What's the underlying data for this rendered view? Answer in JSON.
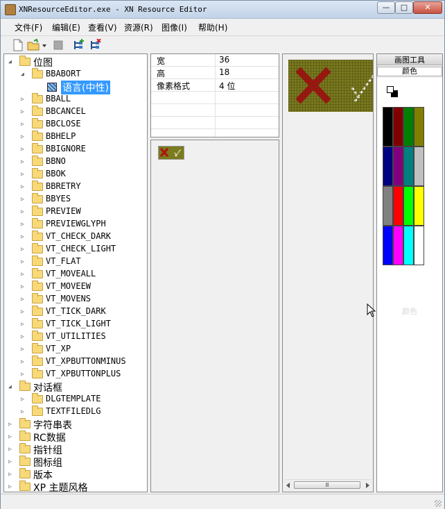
{
  "window": {
    "title": "XNResourceEditor.exe - XN Resource Editor"
  },
  "title_buttons": {
    "minimize": "—",
    "maximize": "□",
    "close": "✕"
  },
  "menu": [
    "文件(F)",
    "编辑(E)",
    "查看(V)",
    "资源(R)",
    "图像(I)",
    "帮助(H)"
  ],
  "tree": [
    {
      "label": "位图",
      "cn": true,
      "level": 0,
      "expanded": true
    },
    {
      "label": "BBABORT",
      "level": 1,
      "expanded": true
    },
    {
      "label": "语言(中性)",
      "cn": true,
      "level": 2,
      "selected": true
    },
    {
      "label": "BBALL",
      "level": 1
    },
    {
      "label": "BBCANCEL",
      "level": 1
    },
    {
      "label": "BBCLOSE",
      "level": 1
    },
    {
      "label": "BBHELP",
      "level": 1
    },
    {
      "label": "BBIGNORE",
      "level": 1
    },
    {
      "label": "BBNO",
      "level": 1
    },
    {
      "label": "BBOK",
      "level": 1
    },
    {
      "label": "BBRETRY",
      "level": 1
    },
    {
      "label": "BBYES",
      "level": 1
    },
    {
      "label": "PREVIEW",
      "level": 1
    },
    {
      "label": "PREVIEWGLYPH",
      "level": 1
    },
    {
      "label": "VT_CHECK_DARK",
      "level": 1
    },
    {
      "label": "VT_CHECK_LIGHT",
      "level": 1
    },
    {
      "label": "VT_FLAT",
      "level": 1
    },
    {
      "label": "VT_MOVEALL",
      "level": 1
    },
    {
      "label": "VT_MOVEEW",
      "level": 1
    },
    {
      "label": "VT_MOVENS",
      "level": 1
    },
    {
      "label": "VT_TICK_DARK",
      "level": 1
    },
    {
      "label": "VT_TICK_LIGHT",
      "level": 1
    },
    {
      "label": "VT_UTILITIES",
      "level": 1
    },
    {
      "label": "VT_XP",
      "level": 1
    },
    {
      "label": "VT_XPBUTTONMINUS",
      "level": 1
    },
    {
      "label": "VT_XPBUTTONPLUS",
      "level": 1
    },
    {
      "label": "对话框",
      "cn": true,
      "level": 0,
      "expanded": true
    },
    {
      "label": "DLGTEMPLATE",
      "level": 1
    },
    {
      "label": "TEXTFILEDLG",
      "level": 1
    },
    {
      "label": "字符串表",
      "cn": true,
      "level": 0
    },
    {
      "label": "RC数据",
      "cn": true,
      "level": 0
    },
    {
      "label": "指针组",
      "cn": true,
      "level": 0
    },
    {
      "label": "图标组",
      "cn": true,
      "level": 0
    },
    {
      "label": "版本",
      "cn": true,
      "level": 0
    },
    {
      "label": "XP 主题风格",
      "cn": true,
      "level": 0
    }
  ],
  "properties": [
    {
      "key": "宽",
      "value": "36"
    },
    {
      "key": "高",
      "value": "18"
    },
    {
      "key": "像素格式",
      "value": "4 位"
    }
  ],
  "tools": {
    "title": "画图工具",
    "color_tab": "颜色",
    "faint_label": "颜色"
  },
  "palette": [
    "#000000",
    "#800000",
    "#008000",
    "#808000",
    "#000080",
    "#800080",
    "#008080",
    "#c0c0c0",
    "#808080",
    "#ff0000",
    "#00ff00",
    "#ffff00",
    "#0000ff",
    "#ff00ff",
    "#00ffff",
    "#ffffff"
  ],
  "scroll": {
    "thumb": "Ⅲ"
  }
}
